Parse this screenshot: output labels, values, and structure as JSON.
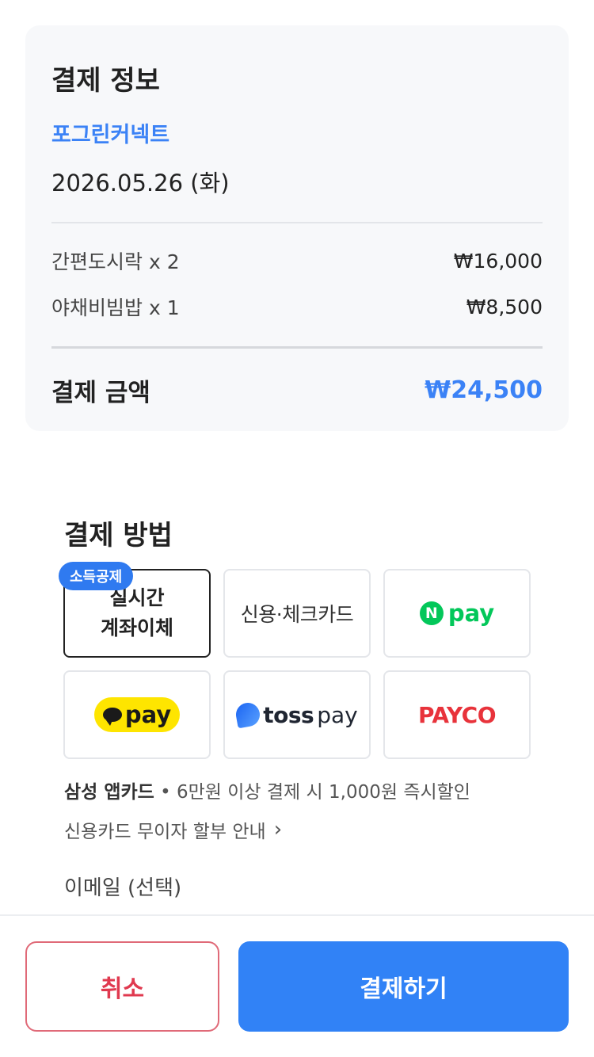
{
  "summary": {
    "title": "결제 정보",
    "store": "포그린커넥트",
    "date": "2026.05.26 (화)",
    "items": [
      {
        "name": "간편도시락 x 2",
        "price": "₩16,000"
      },
      {
        "name": "야채비빔밥 x 1",
        "price": "₩8,500"
      }
    ],
    "total_label": "결제 금액",
    "total_value": "₩24,500"
  },
  "payment_methods": {
    "title": "결제 방법",
    "badge": "소득공제",
    "bank_transfer_line1": "실시간",
    "bank_transfer_line2": "계좌이체",
    "card": "신용·체크카드",
    "npay_mark": "N",
    "npay": "pay",
    "kakaopay": "pay",
    "toss_bold": "toss",
    "toss_light": "pay",
    "payco": "PAYCO",
    "selected": "실시간 계좌이체"
  },
  "promo": {
    "bold": "삼성 앱카드",
    "text": "• 6만원 이상 결제 시 1,000원 즉시할인"
  },
  "installment": {
    "label": "신용카드 무이자 할부 안내",
    "chevron": "›"
  },
  "email": {
    "label": "이메일  (선택)"
  },
  "actions": {
    "cancel": "취소",
    "pay": "결제하기"
  },
  "colors": {
    "accent": "#3182f6",
    "cancel": "#e0394f",
    "npay": "#03c75a",
    "kakao": "#fee500",
    "payco": "#e8333b"
  }
}
